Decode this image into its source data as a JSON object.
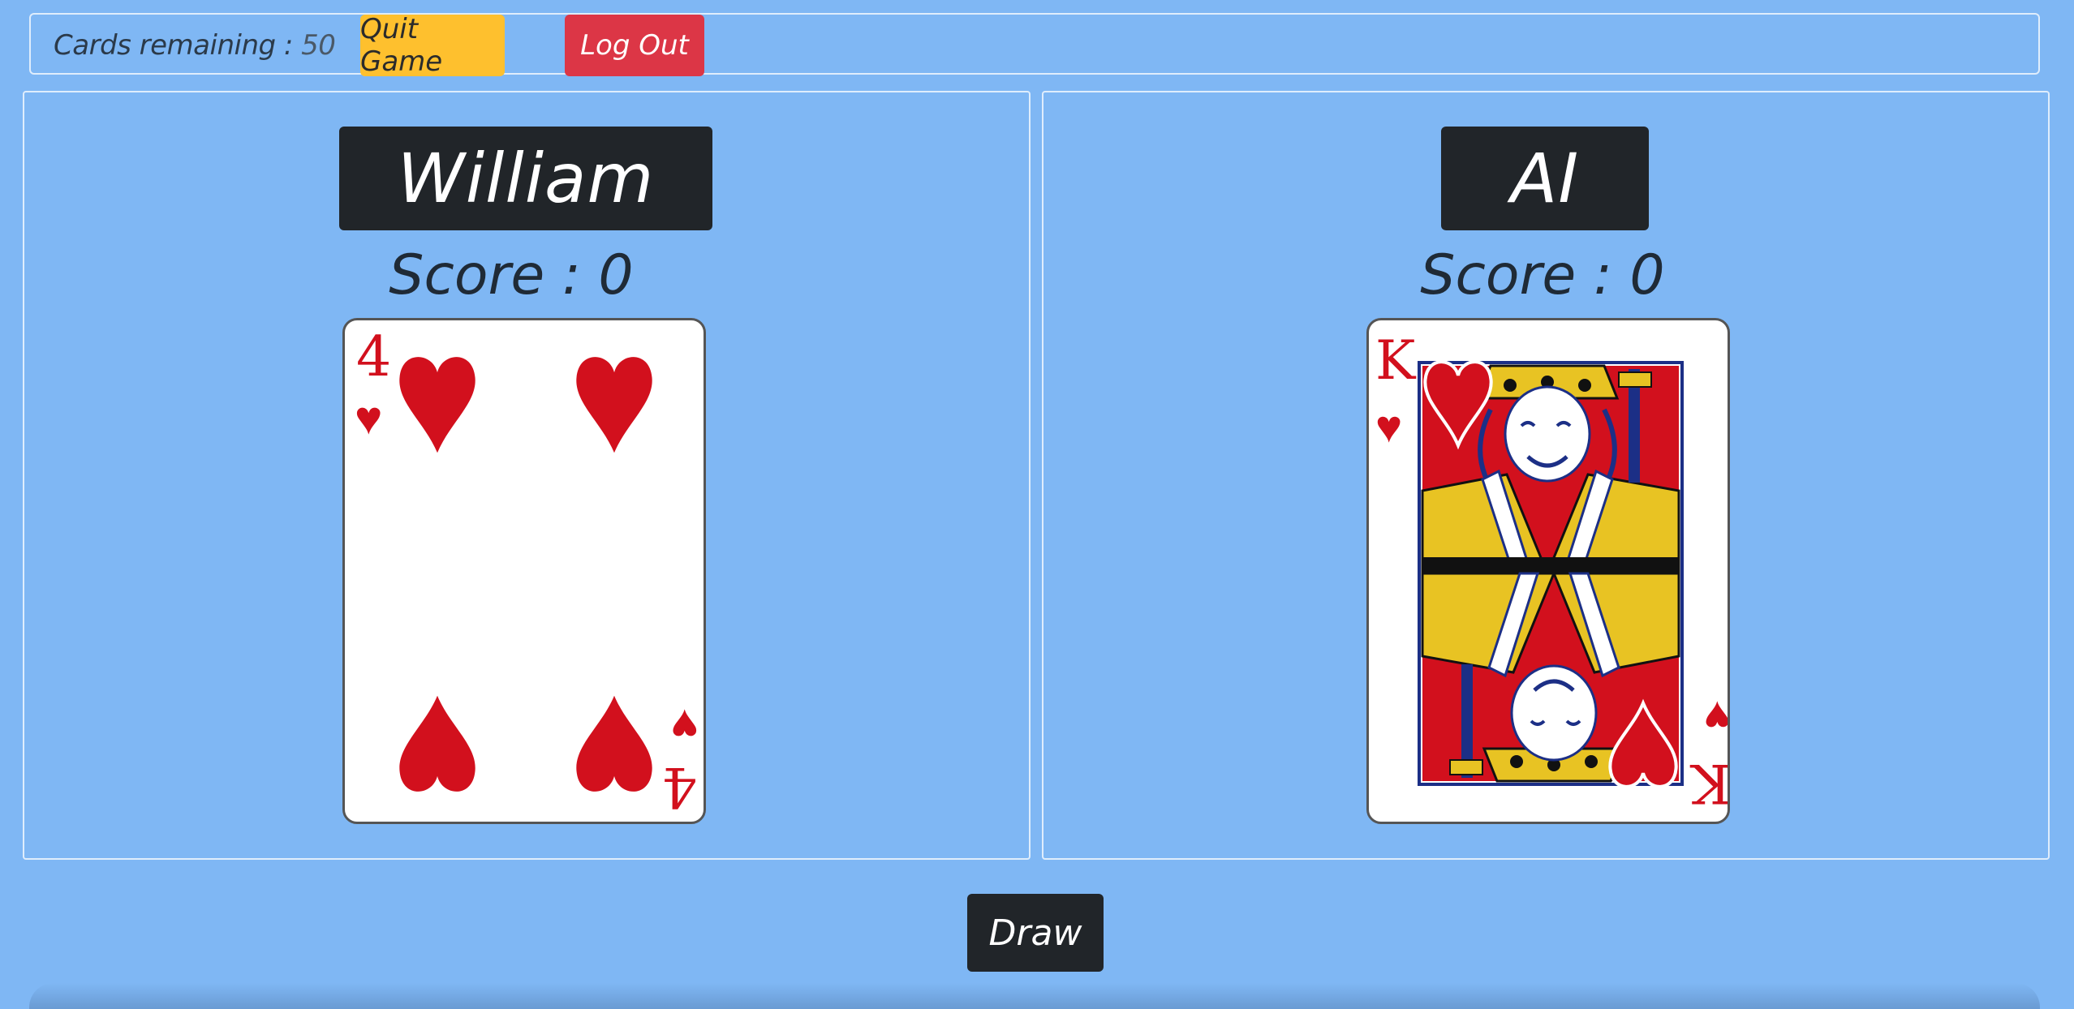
{
  "topbar": {
    "cards_remaining_label": "Cards remaining :",
    "cards_remaining_count": "50",
    "quit_label": "Quit Game",
    "logout_label": "Log Out"
  },
  "players": [
    {
      "name": "William",
      "score_label": "Score",
      "score_sep": ":",
      "score_value": "0",
      "card": {
        "rank": "4",
        "suit": "hearts",
        "suit_symbol": "♥",
        "color": "#d2101d"
      }
    },
    {
      "name": "AI",
      "score_label": "Score",
      "score_sep": ":",
      "score_value": "0",
      "card": {
        "rank": "K",
        "suit": "hearts",
        "suit_symbol": "♥",
        "color": "#d2101d"
      }
    }
  ],
  "draw_label": "Draw",
  "colors": {
    "background": "#7fb7f4",
    "quit_button": "#fec02e",
    "logout_button": "#dc3646",
    "dark": "#212529",
    "heart_red": "#d2101d"
  }
}
